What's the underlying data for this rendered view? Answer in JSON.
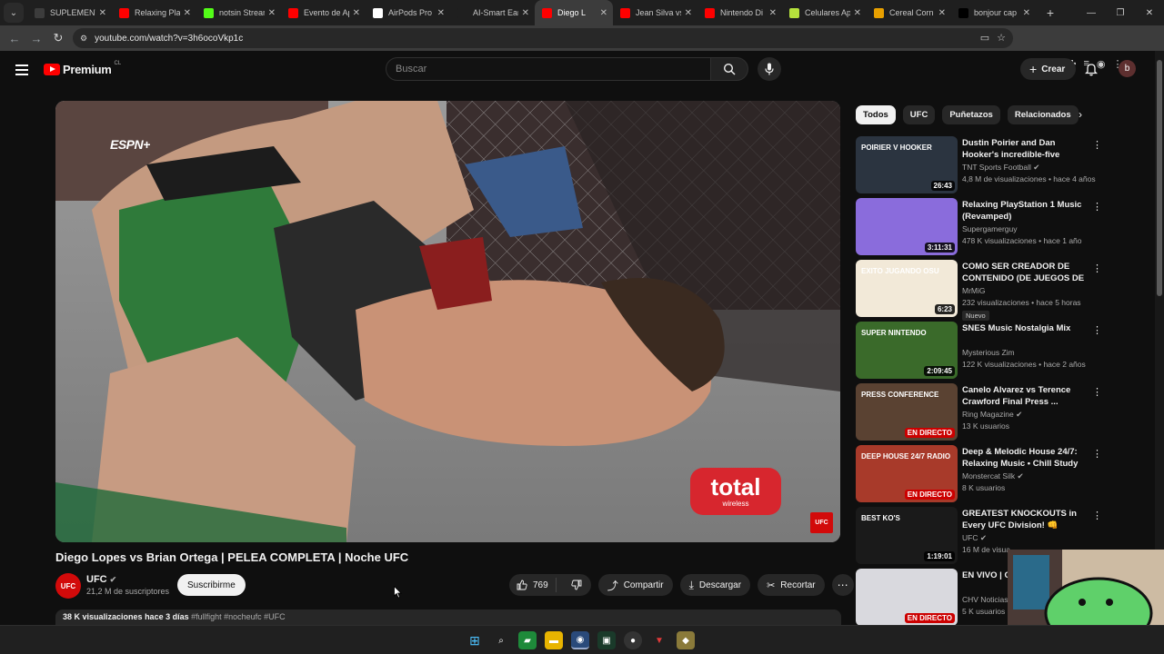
{
  "browser": {
    "tabs": [
      {
        "label": "SUPLEMENT",
        "fav_color": "#3c3c3c",
        "fav_icon": "globe-icon"
      },
      {
        "label": "Relaxing Play",
        "fav_color": "#ff0000",
        "fav_icon": "youtube-icon"
      },
      {
        "label": "notsin Stream",
        "fav_color": "#53fc18",
        "fav_icon": "kick-icon"
      },
      {
        "label": "Evento de Ap",
        "fav_color": "#ff0000",
        "fav_icon": "youtube-icon"
      },
      {
        "label": "AirPods Pro",
        "fav_color": "#ffffff",
        "fav_icon": "apple-icon"
      },
      {
        "label": "AI-Smart Ear",
        "fav_color": "#1f1f1f",
        "fav_icon": "ai-icon"
      },
      {
        "label": "Diego L",
        "fav_color": "#ff0000",
        "fav_icon": "youtube-icon",
        "active": true
      },
      {
        "label": "Jean Silva vs",
        "fav_color": "#ff0000",
        "fav_icon": "youtube-icon"
      },
      {
        "label": "Nintendo Di",
        "fav_color": "#ff0000",
        "fav_icon": "youtube-icon"
      },
      {
        "label": "Celulares Ap",
        "fav_color": "#b6e23c",
        "fav_icon": "store-icon"
      },
      {
        "label": "Cereal Corn",
        "fav_color": "#e8a000",
        "fav_icon": "sun-icon"
      },
      {
        "label": "bonjour cap",
        "fav_color": "#000000",
        "fav_icon": "x-icon"
      }
    ],
    "url": "youtube.com/watch?v=3h6ocoVkp1c"
  },
  "yt": {
    "brand": "Premium",
    "country": "CL",
    "search_placeholder": "Buscar",
    "create_label": "Crear",
    "avatar_letter": "b"
  },
  "video": {
    "title": "Diego Lopes vs Brian Ortega | PELEA COMPLETA | Noche UFC",
    "channel": "UFC",
    "channel_avatar": "UFC",
    "subscribers": "21,2 M de suscriptores",
    "subscribe_label": "Suscribirme",
    "likes": "769",
    "share_label": "Compartir",
    "download_label": "Descargar",
    "clip_label": "Recortar",
    "views": "38 K visualizaciones",
    "age": "hace 3 días",
    "hashtags": "#fullfight #nocheufc #UFC",
    "overlay_broadcaster": "ESPN+",
    "sponsor_main": "total",
    "sponsor_sub": "wireless",
    "corner_logo": "UFC"
  },
  "chips": [
    "Todos",
    "UFC",
    "Puñetazos",
    "Relacionados"
  ],
  "recommendations": [
    {
      "title": "Dustin Poirier and Dan Hooker's incredible-five rounder! Full-...",
      "channel": "TNT Sports Football",
      "verified": true,
      "meta": "4,8 M de visualizaciones • hace 4 años",
      "duration": "26:43",
      "thumb_bg": "#2b3440",
      "thumb_text": "POIRIER V HOOKER"
    },
    {
      "title": "Relaxing PlayStation 1 Music (Revamped)",
      "channel": "Supergamerguy",
      "verified": false,
      "meta": "478 K visualizaciones • hace 1 año",
      "duration": "3:11:31",
      "thumb_bg": "#8a6cdc",
      "thumb_text": ""
    },
    {
      "title": "COMO SER CREADOR DE CONTENIDO (DE JUEGOS DE ...",
      "channel": "MrMiG",
      "verified": false,
      "meta": "232 visualizaciones • hace 5 horas",
      "duration": "6:23",
      "badge": "Nuevo",
      "thumb_bg": "#f2e9d8",
      "thumb_text": "EXITO JUGANDO OSU"
    },
    {
      "title": "SNES Music Nostalgia Mix",
      "channel": "Mysterious Zim",
      "verified": false,
      "meta": "122 K visualizaciones • hace 2 años",
      "duration": "2:09:45",
      "thumb_bg": "#3a6a2a",
      "thumb_text": "SUPER NINTENDO"
    },
    {
      "title": "Canelo Alvarez vs Terence Crawford Final Press ...",
      "channel": "Ring Magazine",
      "verified": true,
      "meta": "13 K usuarios",
      "live": "EN DIRECTO",
      "thumb_bg": "#5a4232",
      "thumb_text": "PRESS CONFERENCE"
    },
    {
      "title": "Deep & Melodic House 24/7: Relaxing Music • Chill Study ...",
      "channel": "Monstercat Silk",
      "verified": true,
      "meta": "8 K usuarios",
      "live": "EN DIRECTO",
      "thumb_bg": "#a83a2a",
      "thumb_text": "DEEP HOUSE 24/7 RADIO"
    },
    {
      "title": "GREATEST KNOCKOUTS in Every UFC Division! 👊",
      "channel": "UFC",
      "verified": true,
      "meta": "16 M de visua...",
      "duration": "1:19:01",
      "thumb_bg": "#1a1a1a",
      "thumb_text": "BEST KO'S"
    },
    {
      "title": "EN VIVO | Central: Jue...",
      "channel": "CHV Noticias",
      "verified": false,
      "meta": "5 K usuarios",
      "live": "EN DIRECTO",
      "thumb_bg": "#d9d9de",
      "thumb_text": ""
    }
  ]
}
